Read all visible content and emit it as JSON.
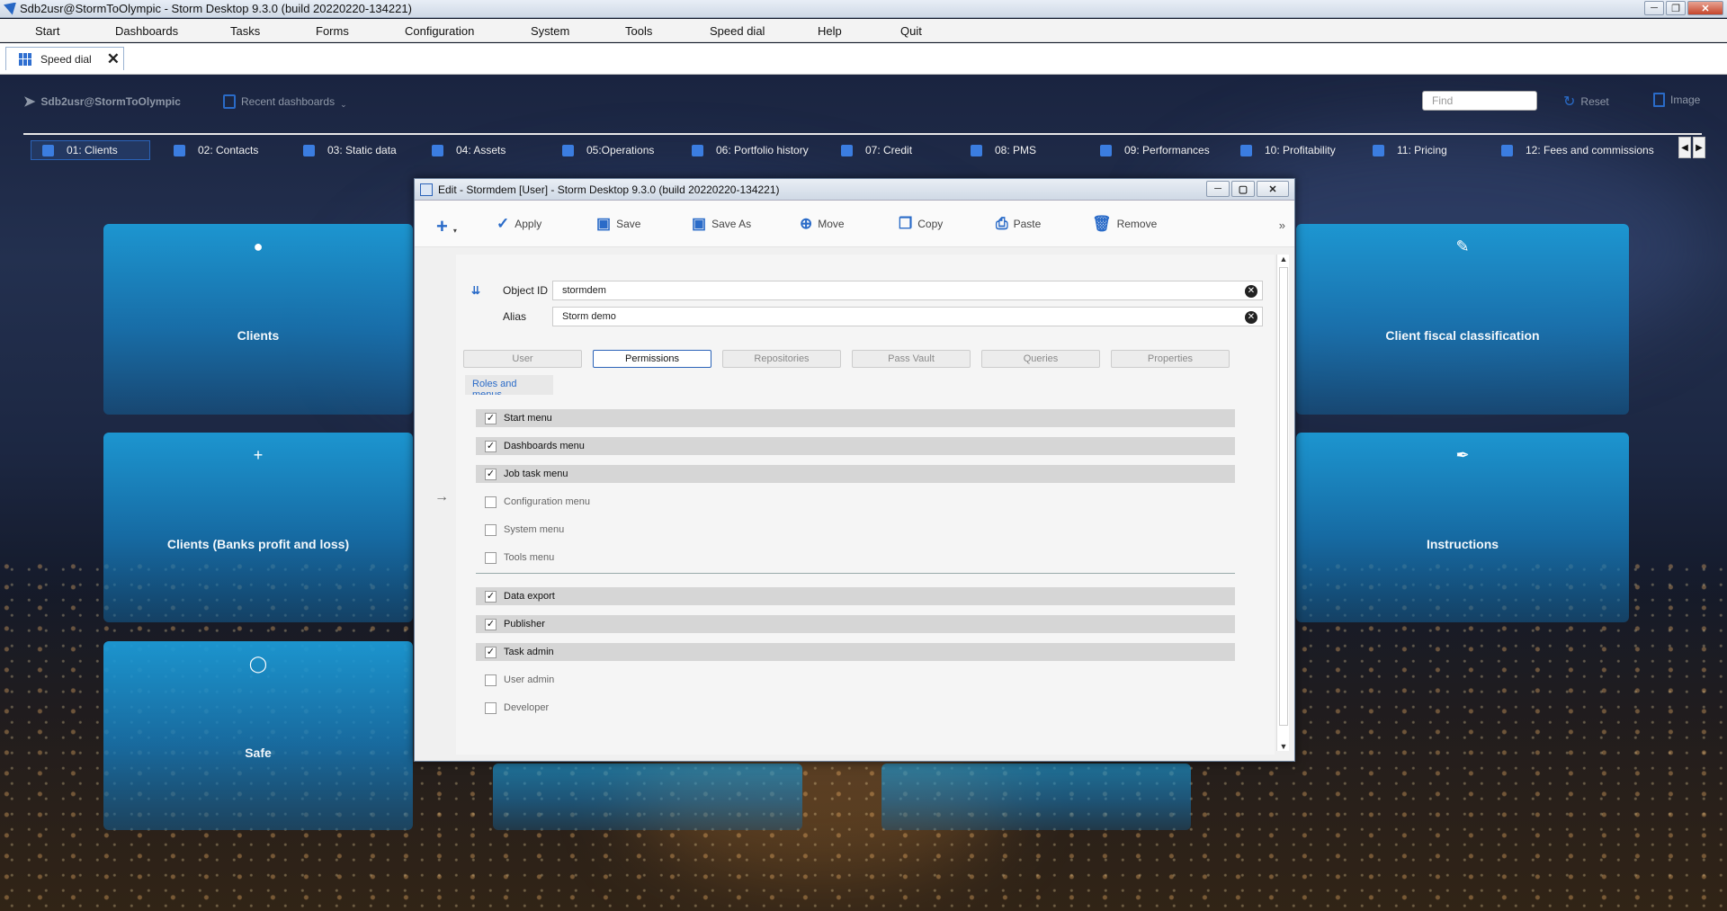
{
  "window": {
    "title": "Sdb2usr@StormToOlympic -  Storm Desktop 9.3.0 (build 20220220-134221)"
  },
  "menubar": [
    "Start",
    "Dashboards",
    "Tasks",
    "Forms",
    "Configuration",
    "System",
    "Tools",
    "Speed dial",
    "Help",
    "Quit"
  ],
  "doc_tab": {
    "label": "Speed dial"
  },
  "header": {
    "user": "Sdb2usr@StormToOlympic",
    "recent": "Recent dashboards",
    "find_placeholder": "Find",
    "reset": "Reset",
    "image": "Image"
  },
  "dashboard_tabs": [
    "01: Clients",
    "02: Contacts",
    "03: Static data",
    "04: Assets",
    "05:Operations",
    "06: Portfolio history",
    "07: Credit",
    "08: PMS",
    "09: Performances",
    "10: Profitability",
    "11: Pricing",
    "12: Fees and commissions"
  ],
  "tiles": [
    "Clients",
    "Client fiscal classification",
    "Clients (Banks profit and loss)",
    "Instructions",
    "Safe"
  ],
  "modal": {
    "title": "Edit - Stormdem [User] -  Storm Desktop 9.3.0 (build 20220220-134221)",
    "toolbar": {
      "apply": "Apply",
      "save": "Save",
      "save_as": "Save As",
      "move": "Move",
      "copy": "Copy",
      "paste": "Paste",
      "remove": "Remove"
    },
    "object_id": {
      "label": "Object ID",
      "value": "stormdem"
    },
    "alias": {
      "label": "Alias",
      "value": "Storm demo"
    },
    "tabs": [
      "User",
      "Permissions",
      "Repositories",
      "Pass Vault",
      "Queries",
      "Properties"
    ],
    "active_tab": "Permissions",
    "section": "Roles and menus",
    "permissions": [
      {
        "label": "Start menu",
        "checked": true
      },
      {
        "label": "Dashboards menu",
        "checked": true
      },
      {
        "label": "Job task menu",
        "checked": true
      },
      {
        "label": "Configuration menu",
        "checked": false
      },
      {
        "label": "System menu",
        "checked": false
      },
      {
        "label": "Tools menu",
        "checked": false
      },
      {
        "label": "Data export",
        "checked": true
      },
      {
        "label": "Publisher",
        "checked": true
      },
      {
        "label": "Task admin",
        "checked": true
      },
      {
        "label": "User admin",
        "checked": false
      },
      {
        "label": "Developer",
        "checked": false
      }
    ]
  }
}
